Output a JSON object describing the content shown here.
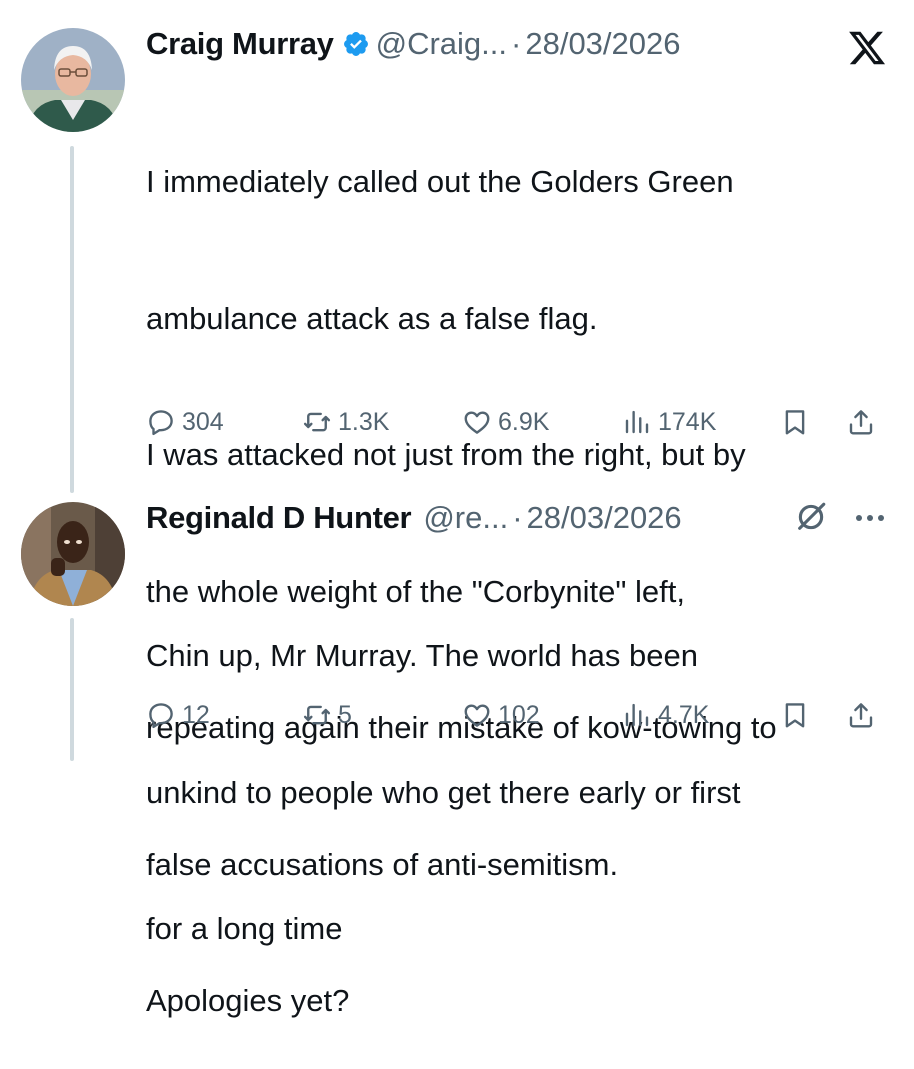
{
  "tweets": [
    {
      "author_name": "Craig Murray",
      "verified": true,
      "handle": "@Craig...",
      "separator": "·",
      "date": "28/03/2026",
      "lines": [
        "I immediately called out the Golders Green",
        "ambulance attack as a false flag.",
        "I was attacked not just from the right, but by",
        "the whole weight of the \"Corbynite\" left,",
        "repeating again their mistake of kow-towing to",
        "false accusations of anti-semitism.",
        "Apologies yet?"
      ],
      "replies": "304",
      "reposts": "1.3K",
      "likes": "6.9K",
      "views": "174K"
    },
    {
      "author_name": "Reginald D Hunter",
      "verified": false,
      "handle": "@re...",
      "separator": "·",
      "date": "28/03/2026",
      "lines": [
        "Chin up, Mr Murray. The world has been",
        "unkind to people who get there early or first",
        "for a long time"
      ],
      "replies": "12",
      "reposts": "5",
      "likes": "102",
      "views": "4.7K"
    }
  ],
  "colors": {
    "text": "#0f1419",
    "muted": "#536471",
    "verified_blue": "#1d9bf0",
    "thread_line": "#cfd9de"
  },
  "icons": [
    "x-logo-icon",
    "verified-badge-icon",
    "reply-icon",
    "repost-icon",
    "like-icon",
    "views-icon",
    "bookmark-icon",
    "share-icon",
    "grok-icon",
    "more-icon"
  ]
}
